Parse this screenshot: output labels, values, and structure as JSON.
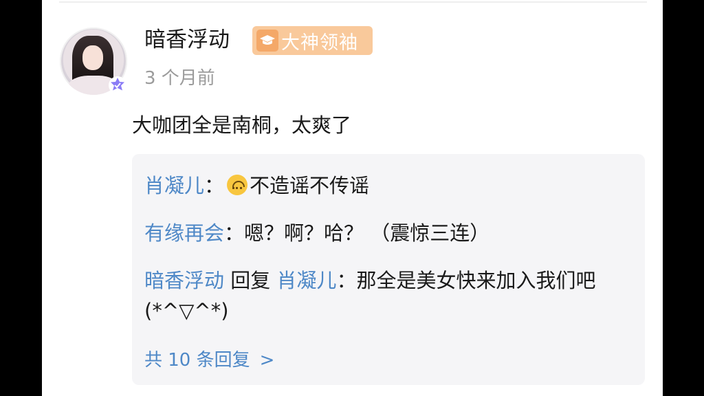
{
  "comment": {
    "username": "暗香浮动",
    "badge_label": "大神领袖",
    "time_ago": "3 个月前",
    "content": "大咖团全是南桐，太爽了"
  },
  "replies": [
    {
      "author": "肖凝儿",
      "separator": "：",
      "text": "不造谣不传谣"
    },
    {
      "author": "有缘再会",
      "separator": "：",
      "text": "嗯？啊？哈？ （震惊三连）"
    },
    {
      "author": "暗香浮动",
      "reply_word": " 回复 ",
      "target": "肖凝儿",
      "separator": "：",
      "text": "那全是美女快来加入我们吧(*^▽^*)"
    }
  ],
  "more_replies_label": "共 10 条回复",
  "more_replies_chevron": ">",
  "colors": {
    "link_blue": "#4e88c7",
    "badge_bg": "#f9c99b",
    "reply_bg": "#f5f5f7",
    "verify_purple": "#8b7cf6"
  },
  "icons": {
    "badge": "graduation-cap-icon",
    "verified": "verified-star-icon",
    "emoji": "upside-down-face-icon"
  }
}
